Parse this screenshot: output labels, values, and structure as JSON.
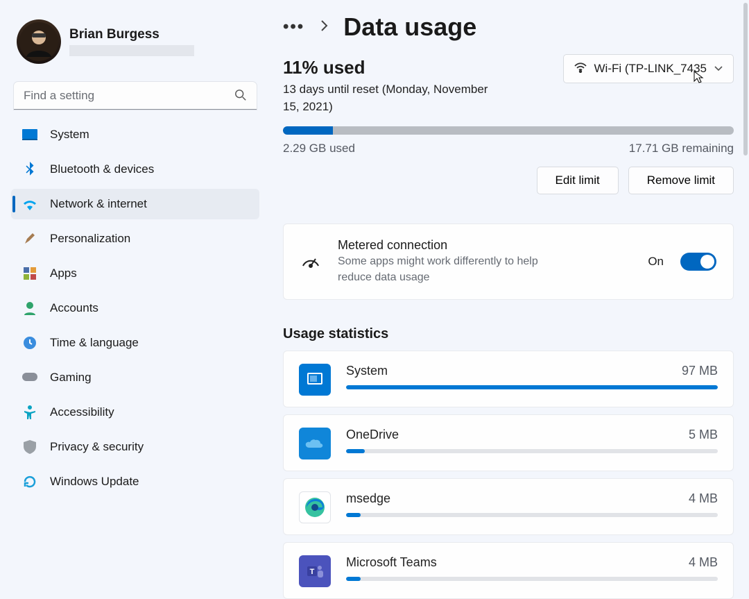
{
  "user": {
    "name": "Brian Burgess"
  },
  "search": {
    "placeholder": "Find a setting"
  },
  "sidebar": {
    "items": [
      {
        "label": "System",
        "icon": "system-icon",
        "color": "#0067c0"
      },
      {
        "label": "Bluetooth & devices",
        "icon": "bluetooth-icon",
        "color": "#0078d4"
      },
      {
        "label": "Network & internet",
        "icon": "wifi-icon",
        "color": "#00a3ee",
        "selected": true
      },
      {
        "label": "Personalization",
        "icon": "paintbrush-icon",
        "color": "#a67c52"
      },
      {
        "label": "Apps",
        "icon": "apps-icon",
        "color": "#4a6ea9"
      },
      {
        "label": "Accounts",
        "icon": "person-icon",
        "color": "#2fa36b"
      },
      {
        "label": "Time & language",
        "icon": "clock-icon",
        "color": "#3a8dde"
      },
      {
        "label": "Gaming",
        "icon": "gamepad-icon",
        "color": "#8a8f99"
      },
      {
        "label": "Accessibility",
        "icon": "accessibility-icon",
        "color": "#0aa3c2"
      },
      {
        "label": "Privacy & security",
        "icon": "shield-icon",
        "color": "#9aa0a6"
      },
      {
        "label": "Windows Update",
        "icon": "update-icon",
        "color": "#1a9fd9"
      }
    ]
  },
  "page": {
    "title": "Data usage",
    "percent_used": "11% used",
    "reset_note": "13 days until reset (Monday, November 15, 2021)",
    "used_label": "2.29 GB used",
    "remaining_label": "17.71 GB remaining",
    "wifi_label": "Wi-Fi (TP-LINK_7435",
    "edit_limit": "Edit limit",
    "remove_limit": "Remove limit"
  },
  "metered": {
    "title": "Metered connection",
    "sub": "Some apps might work differently to help reduce data usage",
    "state": "On"
  },
  "usage_heading": "Usage statistics",
  "apps": [
    {
      "name": "System",
      "value": "97 MB",
      "icon": "system-app-icon",
      "bg": "#0078d4"
    },
    {
      "name": "OneDrive",
      "value": "5 MB",
      "icon": "onedrive-icon",
      "bg": "#1086d9"
    },
    {
      "name": "msedge",
      "value": "4 MB",
      "icon": "edge-icon",
      "bg": "#ffffff"
    },
    {
      "name": "Microsoft Teams",
      "value": "4 MB",
      "icon": "teams-icon",
      "bg": "#4b53bc"
    }
  ]
}
